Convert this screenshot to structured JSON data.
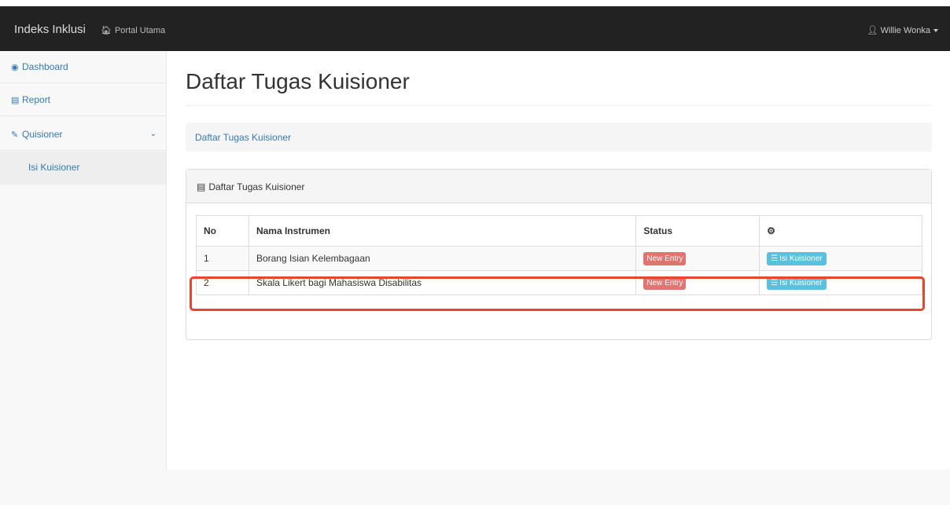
{
  "navbar": {
    "brand": "Indeks Inklusi",
    "portal_icon": "home-icon",
    "portal_label": "Portal Utama",
    "user_icon": "user-icon",
    "user_name": "Willie Wonka"
  },
  "sidebar": {
    "items": [
      {
        "icon": "dashboard-icon",
        "label": "Dashboard"
      },
      {
        "icon": "bar-chart-icon",
        "label": "Report"
      },
      {
        "icon": "edit-icon",
        "label": "Quisioner"
      }
    ],
    "sub_item": "Isi Kuisioner"
  },
  "main": {
    "title": "Daftar Tugas Kuisioner",
    "breadcrumb": "Daftar Tugas Kuisioner",
    "panel_title": "Daftar Tugas Kuisioner",
    "table": {
      "headers": [
        "No",
        "Nama Instrumen",
        "Status",
        ""
      ],
      "settings_icon": "gear-icon",
      "rows": [
        {
          "no": "1",
          "name": "Borang Isian Kelembagaan",
          "status": "New Entry",
          "action": "Isi Kuisioner"
        },
        {
          "no": "2",
          "name": "Skala Likert bagi Mahasiswa Disabilitas",
          "status": "New Entry",
          "action": "Isi Kuisioner"
        }
      ]
    }
  },
  "colors": {
    "navbar": "#222222",
    "link": "#337ab7",
    "label_new": "#d9534f",
    "btn_info": "#5bc0de",
    "highlight": "#e8452c"
  }
}
